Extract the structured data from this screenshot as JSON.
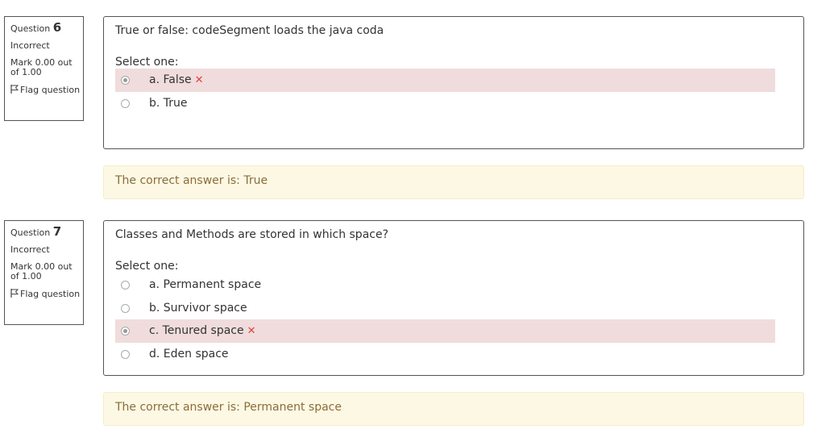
{
  "questions": [
    {
      "number_label": "Question",
      "number": "6",
      "state": "Incorrect",
      "grade": "Mark 0.00 out of 1.00",
      "flag": "Flag question",
      "text": "True or false: codeSegment loads the java coda",
      "prompt": "Select one:",
      "options": [
        {
          "label": "a. False",
          "checked": true,
          "incorrect": true
        },
        {
          "label": "b. True",
          "checked": false,
          "incorrect": false
        }
      ],
      "feedback": "The correct answer is: True"
    },
    {
      "number_label": "Question",
      "number": "7",
      "state": "Incorrect",
      "grade": "Mark 0.00 out of 1.00",
      "flag": "Flag question",
      "text": "Classes and Methods are stored in which space?",
      "prompt": "Select one:",
      "options": [
        {
          "label": "a. Permanent space",
          "checked": false,
          "incorrect": false
        },
        {
          "label": "b. Survivor space",
          "checked": false,
          "incorrect": false
        },
        {
          "label": "c. Tenured space",
          "checked": true,
          "incorrect": true
        },
        {
          "label": "d. Eden space",
          "checked": false,
          "incorrect": false
        }
      ],
      "feedback": "The correct answer is: Permanent space"
    }
  ],
  "icons": {
    "flag": "flag-icon",
    "incorrect": "cross-icon"
  },
  "colors": {
    "incorrect_bg": "#f0dcdc",
    "feedback_bg": "#fcf8e4",
    "cross": "#e0443a"
  }
}
